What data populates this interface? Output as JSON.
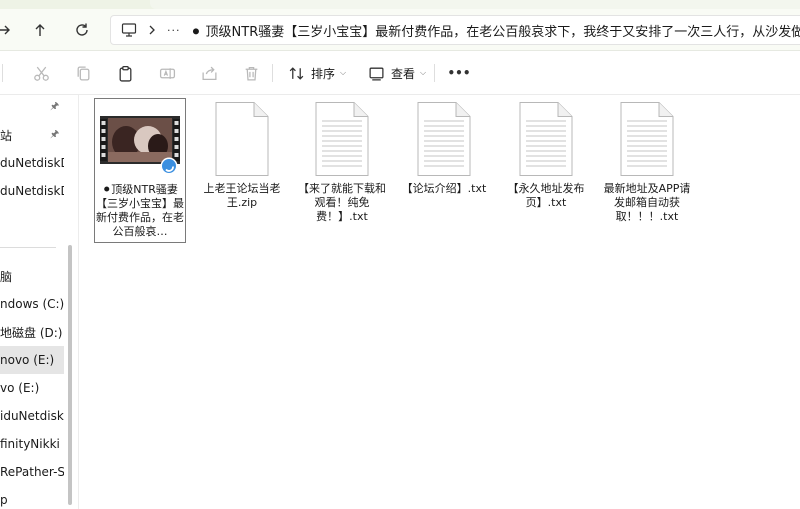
{
  "address_bar": {
    "path_text": "⚫ 顶级NTR骚妻【三岁小宝宝】最新付费作品，在老公百般哀求下，我终于又安排了一次三人行，从沙发做到床"
  },
  "toolbar": {
    "sort_label": "排序",
    "view_label": "查看",
    "more_label": "•••"
  },
  "sidebar": {
    "items": [
      {
        "label": "",
        "pinned": true
      },
      {
        "label": "站",
        "pinned": true
      },
      {
        "label": "duNetdiskDo",
        "pinned": false
      },
      {
        "label": "duNetdiskDo",
        "pinned": false
      },
      {
        "label": "脑",
        "pinned": false
      },
      {
        "label": "ndows (C:)",
        "pinned": false
      },
      {
        "label": "地磁盘 (D:)",
        "pinned": false
      },
      {
        "label": "novo (E:)",
        "pinned": false,
        "selected": true
      },
      {
        "label": "vo (E:)",
        "pinned": false
      },
      {
        "label": "iduNetdiskD",
        "pinned": false
      },
      {
        "label": "finityNikki La",
        "pinned": false
      },
      {
        "label": "RePather-Sky",
        "pinned": false
      },
      {
        "label": "p",
        "pinned": false
      }
    ]
  },
  "files": [
    {
      "name": "⚫顶级NTR骚妻【三岁小宝宝】最新付费作品，在老公百般哀…",
      "kind": "video",
      "selected": true
    },
    {
      "name": "上老王论坛当老王.zip",
      "kind": "blank-file"
    },
    {
      "name": "【来了就能下载和观看！纯免费！】.txt",
      "kind": "text-file"
    },
    {
      "name": "【论坛介绍】.txt",
      "kind": "text-file"
    },
    {
      "name": "【永久地址发布页】.txt",
      "kind": "text-file"
    },
    {
      "name": "最新地址及APP请发邮箱自动获取！！！.txt",
      "kind": "text-file"
    }
  ],
  "colors": {
    "accent": "#0067c0",
    "selection": "#e5e5e5"
  }
}
